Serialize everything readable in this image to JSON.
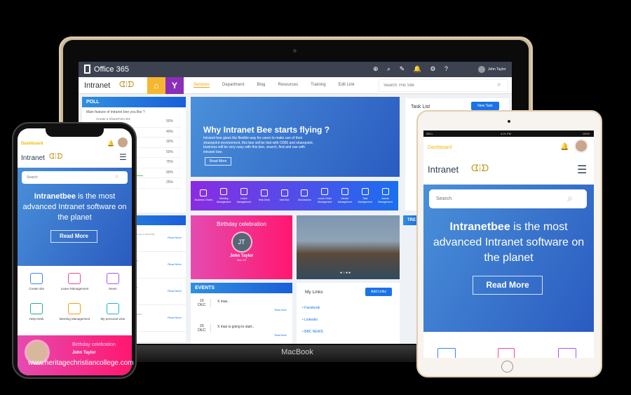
{
  "laptop": {
    "brand": "MacBook",
    "topbar": {
      "app": "Office 365",
      "user": "John Taylor"
    },
    "nav": {
      "logo": "Intranet",
      "items": [
        "Services",
        "Department",
        "Blog",
        "Resources",
        "Training",
        "Edit Link"
      ],
      "search_placeholder": "Search This Site"
    },
    "poll": {
      "title": "POLL",
      "question": "Main feature of intranet bee you like ?",
      "first_option": "Create a SharePoint site",
      "percents": [
        "50%",
        "40%",
        "30%",
        "50%",
        "75%",
        "90%",
        "25%"
      ],
      "bars": [
        50,
        40,
        30,
        50,
        75,
        90,
        25
      ]
    },
    "hero": {
      "title": "Why Intranet Bee starts flying ?",
      "body": "Intranet bee gives the flexible way for users to make use of their sharepoint environment, this bee will be tied with O365 and sharepoint, business will be very easy with this bee, search, find and use with intranet bee.",
      "button": "Read More"
    },
    "apps": [
      "Business Charts",
      "Meeting Management",
      "Leave Management",
      "Help Desk",
      "Idea Box",
      "Discussions",
      "Lunch Order Management",
      "Vendor Management",
      "Task Management",
      "Assets Management"
    ],
    "tasks": {
      "title": "Task List",
      "button": "New Task"
    },
    "news": [
      {
        "title": "...le heating",
        "body": "...options have been found to ...to a probe by a security",
        "link": "Read More"
      },
      {
        "title": "...neutrality",
        "body": "...ng and hand for what they ...the internet",
        "link": "Read More"
      },
      {
        "title": "...d by US regulator",
        "body": "...mission voted three to ...ty\" is governed.",
        "link": "Read More"
      },
      {
        "title": "...early contract exit",
        "body": "...otential sour mounting ...e European Union",
        "link": "Read More"
      }
    ],
    "birthday": {
      "title": "Birthday celebration",
      "initials": "JT",
      "name": "John Taylor",
      "date": "Nov 23"
    },
    "events": {
      "title": "EVENTS",
      "items": [
        {
          "day": "15",
          "month": "DEC",
          "text": "X mas..",
          "link": "Read More"
        },
        {
          "day": "26",
          "month": "DEC",
          "text": "X mas is going to start..",
          "link": "Read More"
        }
      ]
    },
    "links": {
      "title": "My Links",
      "button": "Add Links",
      "items": [
        "Facebook",
        "Linkedin",
        "BBC NEWS"
      ]
    },
    "trending_label": "TRE"
  },
  "phone": {
    "dashboard": "Dashboard",
    "logo": "Intranet",
    "search_placeholder": "Search",
    "hero_bold": "Intranetbee",
    "hero_rest": " is the most advanced Intranet software on the planet",
    "button": "Read More",
    "tiles": [
      "Create site",
      "Leave Management",
      "News",
      "Help Desk",
      "Meeting Management",
      "My personal view"
    ],
    "birthday": {
      "title": "Birthday celebration",
      "name": "John Taylor"
    }
  },
  "tablet": {
    "status": {
      "carrier": "BELL",
      "time": "4:21 PM",
      "battery": "100%"
    },
    "dashboard": "Dashboard",
    "logo": "Intranet",
    "search_placeholder": "Search",
    "hero_bold": "Intranetbee",
    "hero_rest": " is the most advanced Intranet software on the planet",
    "button": "Read More"
  },
  "watermark": "www.heritagechristiancollege.com",
  "colors": {
    "accent": "#1a73e8",
    "pink": "#f0308a",
    "dashboard": "#f5b800",
    "topbar": "#3d4250"
  }
}
